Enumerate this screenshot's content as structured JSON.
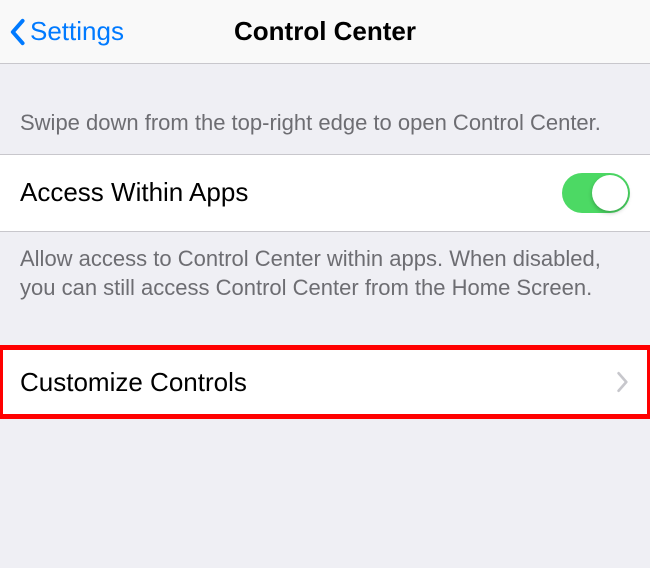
{
  "nav": {
    "back_label": "Settings",
    "title": "Control Center"
  },
  "sections": {
    "intro_text": "Swipe down from the top-right edge to open Control Center.",
    "access_within_apps": {
      "label": "Access Within Apps",
      "toggle_on": true,
      "footer": "Allow access to Control Center within apps. When disabled, you can still access Control Center from the Home Screen."
    },
    "customize": {
      "label": "Customize Controls"
    }
  }
}
